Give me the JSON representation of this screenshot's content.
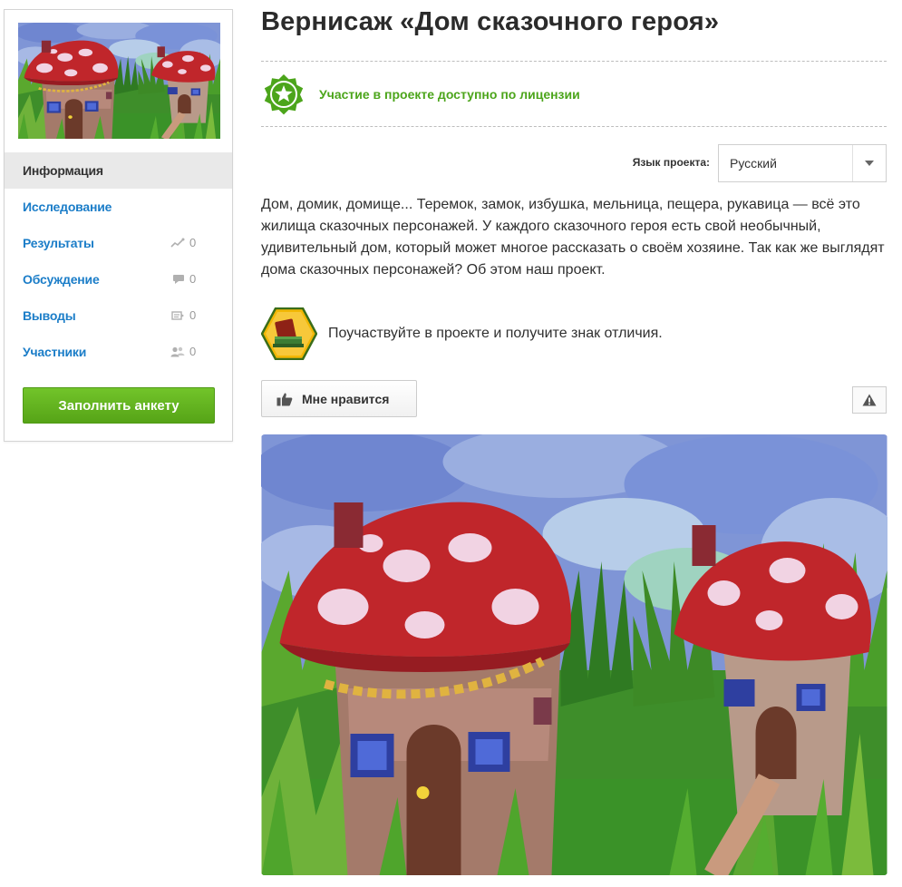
{
  "page": {
    "title": "Вернисаж «Дом сказочного героя»",
    "license_text": "Участие в проекте доступно по лицензии",
    "language_label": "Язык проекта:",
    "language_value": "Русский",
    "description": "Дом, домик, домище... Теремок, замок, избушка, мельница, пещера, рукавица — всё это жилища сказочных персонажей. У каждого сказочного героя есть свой необычный, удивительный дом, который может многое рассказать о своём хозяине. Так как же выглядят дома сказочных персонажей? Об этом наш проект.",
    "badge_text": "Поучаствуйте в проекте и получите знак отличия.",
    "like_label": "Мне нравится"
  },
  "sidebar": {
    "items": [
      {
        "label": "Информация",
        "active": true
      },
      {
        "label": "Исследование"
      },
      {
        "label": "Результаты",
        "count": "0",
        "icon": "chart-icon"
      },
      {
        "label": "Обсуждение",
        "count": "0",
        "icon": "comment-icon"
      },
      {
        "label": "Выводы",
        "count": "0",
        "icon": "note-icon"
      },
      {
        "label": "Участники",
        "count": "0",
        "icon": "users-icon"
      }
    ],
    "fill_button": "Заполнить анкету"
  },
  "colors": {
    "accent_green": "#4ca51b",
    "link_blue": "#1b7dc8",
    "button_green": "#5cac1c"
  }
}
